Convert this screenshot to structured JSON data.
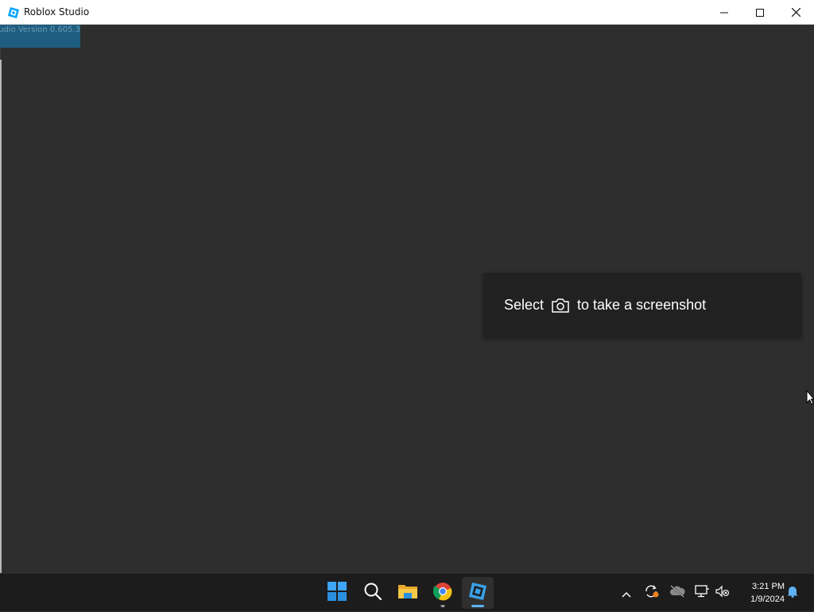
{
  "window": {
    "title": "Roblox Studio",
    "icons": {
      "app": "roblox-studio-icon",
      "minimize": "minimize-icon",
      "maximize": "maximize-icon",
      "close": "close-icon"
    }
  },
  "version_badge": {
    "text": "udio Version 0.605.3"
  },
  "toast": {
    "text_before": "Select",
    "icon": "camera-icon",
    "text_after": "to take a screenshot"
  },
  "taskbar": {
    "apps": [
      {
        "name": "start",
        "icon": "windows-start-icon"
      },
      {
        "name": "search",
        "icon": "search-icon"
      },
      {
        "name": "file-explorer",
        "icon": "folder-icon"
      },
      {
        "name": "chrome",
        "icon": "chrome-icon",
        "running": true
      },
      {
        "name": "roblox-studio",
        "icon": "roblox-studio-icon",
        "active": true
      }
    ],
    "tray_icons": [
      "chevron-up-icon",
      "sync-icon",
      "cloud-offline-icon",
      "network-icon",
      "volume-muted-icon"
    ],
    "clock": {
      "time": "3:21 PM",
      "date": "1/9/2024"
    },
    "notification_icon": "bell-icon"
  },
  "colors": {
    "background": "#2e2e2e",
    "toast_bg": "#212121",
    "taskbar_bg": "#1c1c1c",
    "accent": "#5fb2f2",
    "badge_bg": "#1f5d80"
  }
}
